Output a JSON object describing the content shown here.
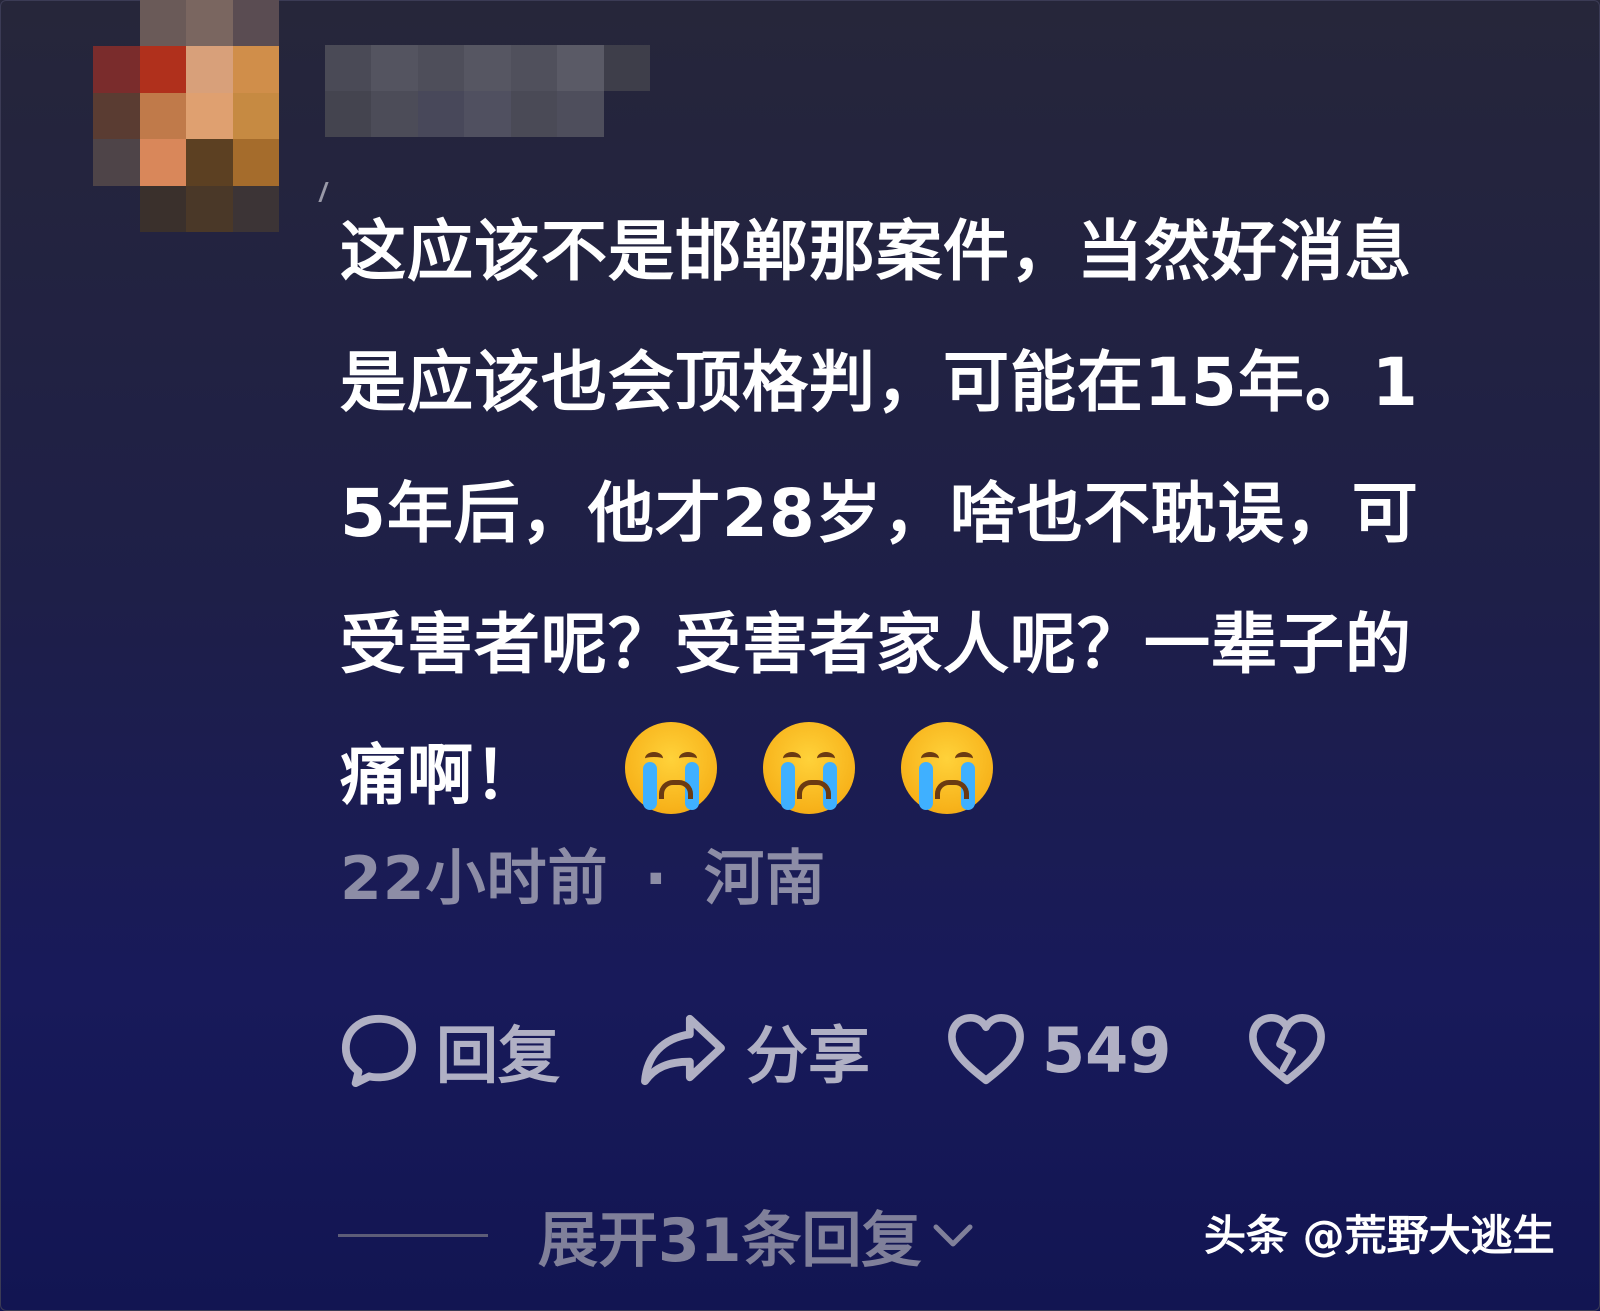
{
  "comment": {
    "lines": [
      "这应该不是邯郸那案件，当然好消息",
      "是应该也会顶格判，可能在15年。1",
      "5年后，他才28岁，啥也不耽误，可",
      "受害者呢？受害者家人呢？一辈子的",
      "痛啊！"
    ],
    "emojis": [
      "crying-face",
      "crying-face",
      "crying-face"
    ],
    "time": "22小时前",
    "separator": "·",
    "location": "河南"
  },
  "actions": {
    "reply_label": "回复",
    "share_label": "分享",
    "like_count": "549"
  },
  "expand_replies_label": "展开31条回复",
  "watermark": "头条 @荒野大逃生",
  "colors": {
    "background_top": "#26263a",
    "background_bottom": "#121552",
    "meta_text": "#8d8da6",
    "action_text": "#b0b0c4"
  }
}
